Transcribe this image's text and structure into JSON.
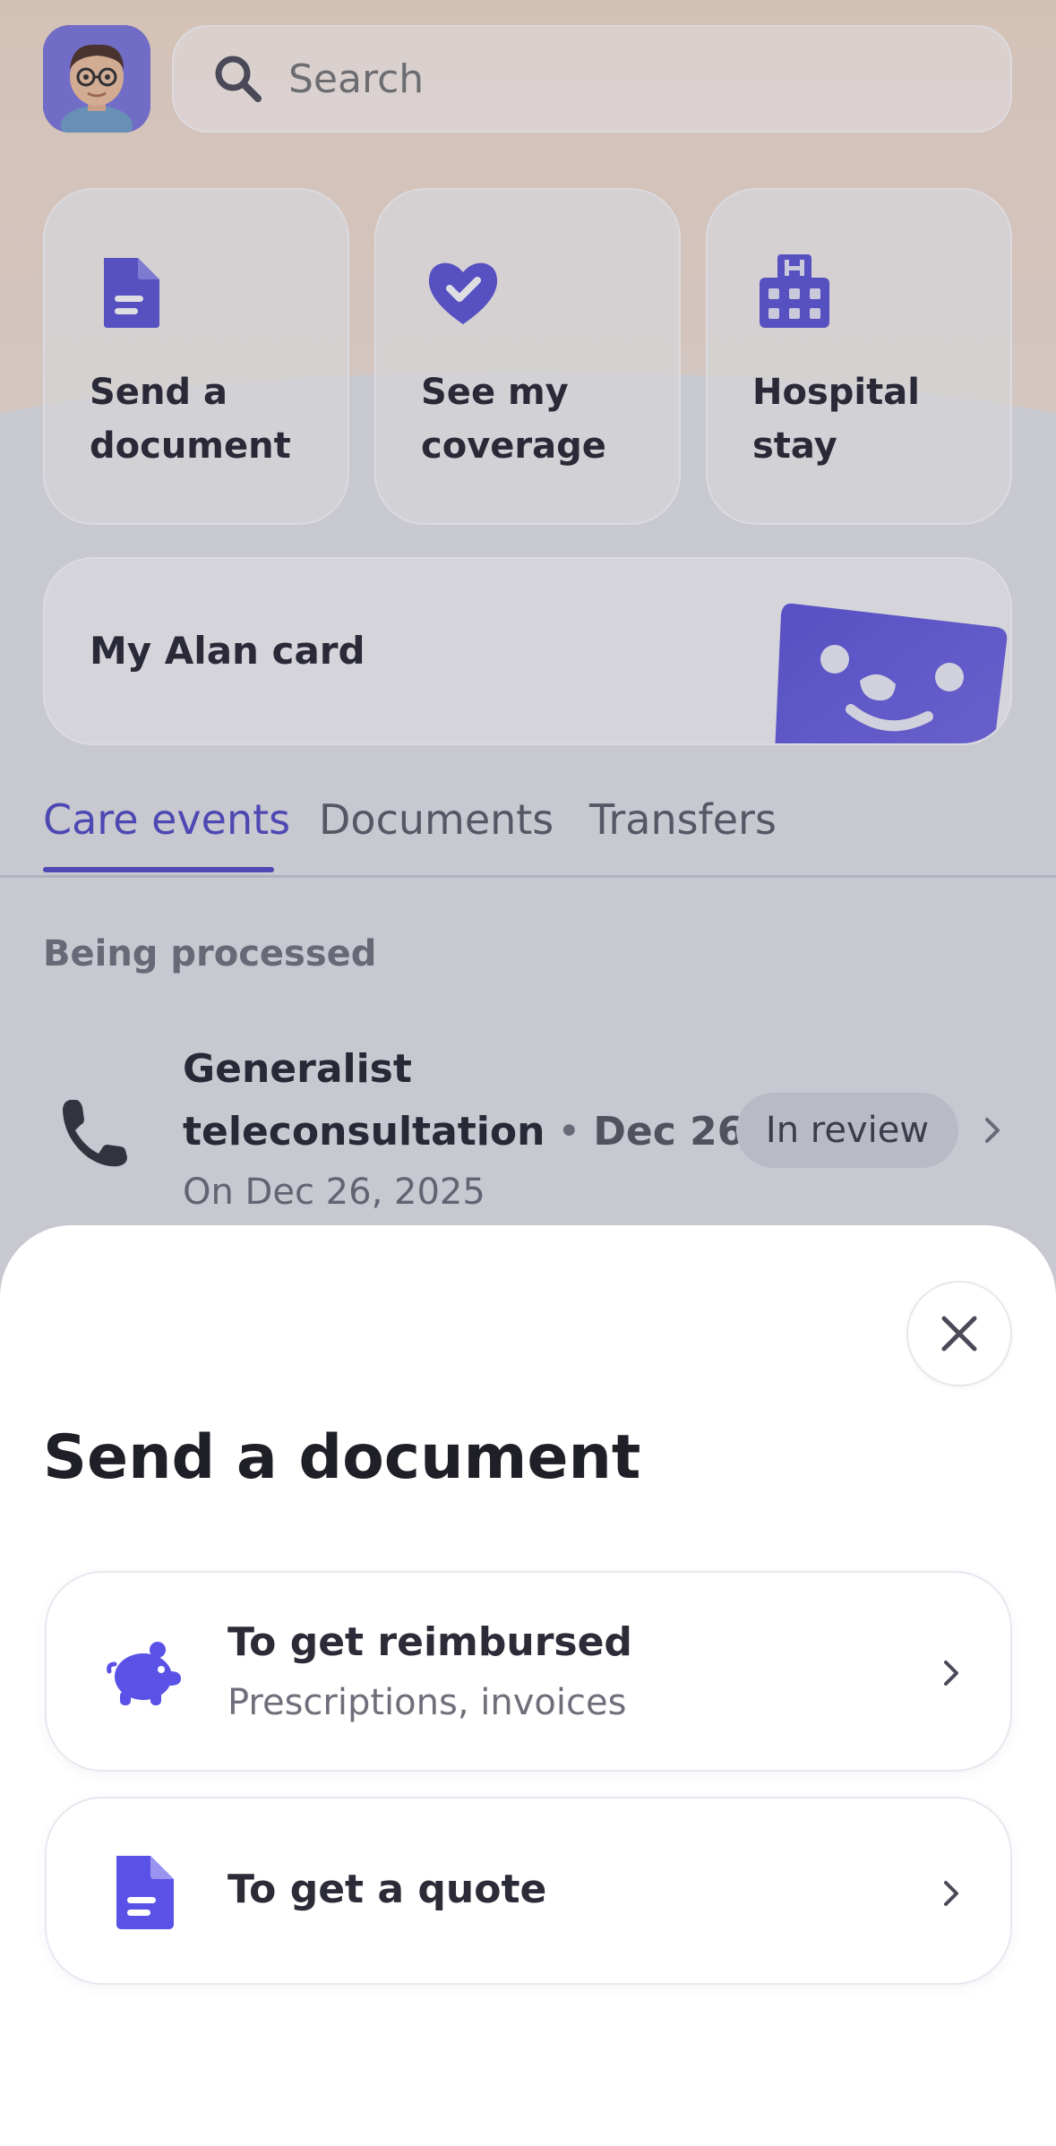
{
  "search": {
    "placeholder": "Search"
  },
  "shortcuts": [
    {
      "label": "Send a document",
      "icon": "document-icon"
    },
    {
      "label": "See my coverage",
      "icon": "heart-check-icon"
    },
    {
      "label": "Hospital stay",
      "icon": "hospital-icon"
    }
  ],
  "alan_card": {
    "label": "My Alan card"
  },
  "tabs": [
    {
      "label": "Care events",
      "active": true
    },
    {
      "label": "Documents",
      "active": false
    },
    {
      "label": "Transfers",
      "active": false
    }
  ],
  "section": {
    "title": "Being processed"
  },
  "event": {
    "title_line1": "Generalist",
    "title_line2": "teleconsultation",
    "separator": "•",
    "short_date": "Dec 26",
    "subtitle": "On Dec 26, 2025",
    "status": "In review"
  },
  "sheet": {
    "title": "Send a document",
    "options": [
      {
        "title": "To get reimbursed",
        "subtitle": "Prescriptions, invoices",
        "icon": "piggy-bank-icon"
      },
      {
        "title": "To get a quote",
        "subtitle": "",
        "icon": "document-icon"
      }
    ]
  },
  "colors": {
    "accent": "#4f49c4",
    "icon_purple": "#5a52d6",
    "badge_bg": "#d3d4dc"
  }
}
